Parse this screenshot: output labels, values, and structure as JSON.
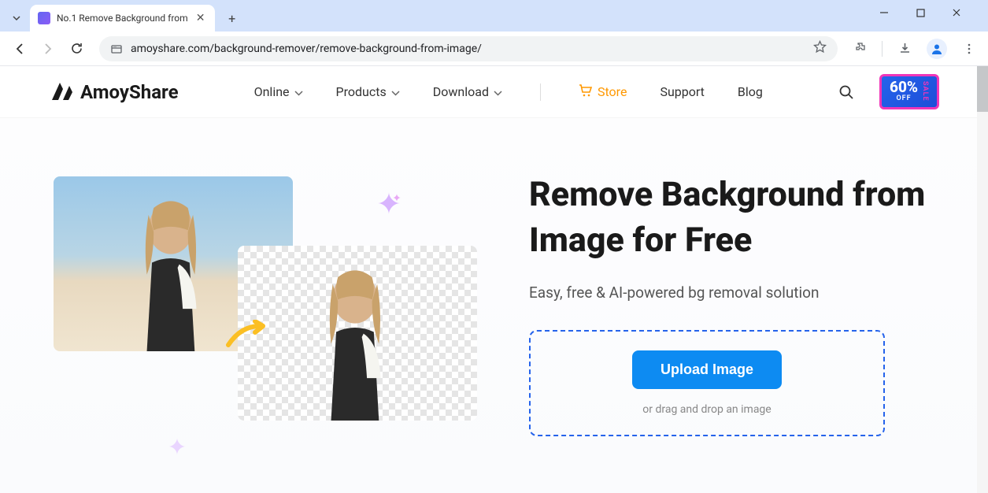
{
  "browser": {
    "tab_title": "No.1 Remove Background from",
    "url": "amoyshare.com/background-remover/remove-background-from-image/"
  },
  "header": {
    "logo_text": "AmoyShare",
    "nav": [
      {
        "label": "Online",
        "has_dropdown": true
      },
      {
        "label": "Products",
        "has_dropdown": true
      },
      {
        "label": "Download",
        "has_dropdown": true
      }
    ],
    "store_label": "Store",
    "support_label": "Support",
    "blog_label": "Blog",
    "sale_percent": "60%",
    "sale_off": "OFF",
    "sale_side": "SALE"
  },
  "hero": {
    "title": "Remove Background from Image for Free",
    "subtitle": "Easy, free & AI-powered bg removal solution",
    "upload_button": "Upload Image",
    "upload_hint": "or drag and drop an image"
  }
}
